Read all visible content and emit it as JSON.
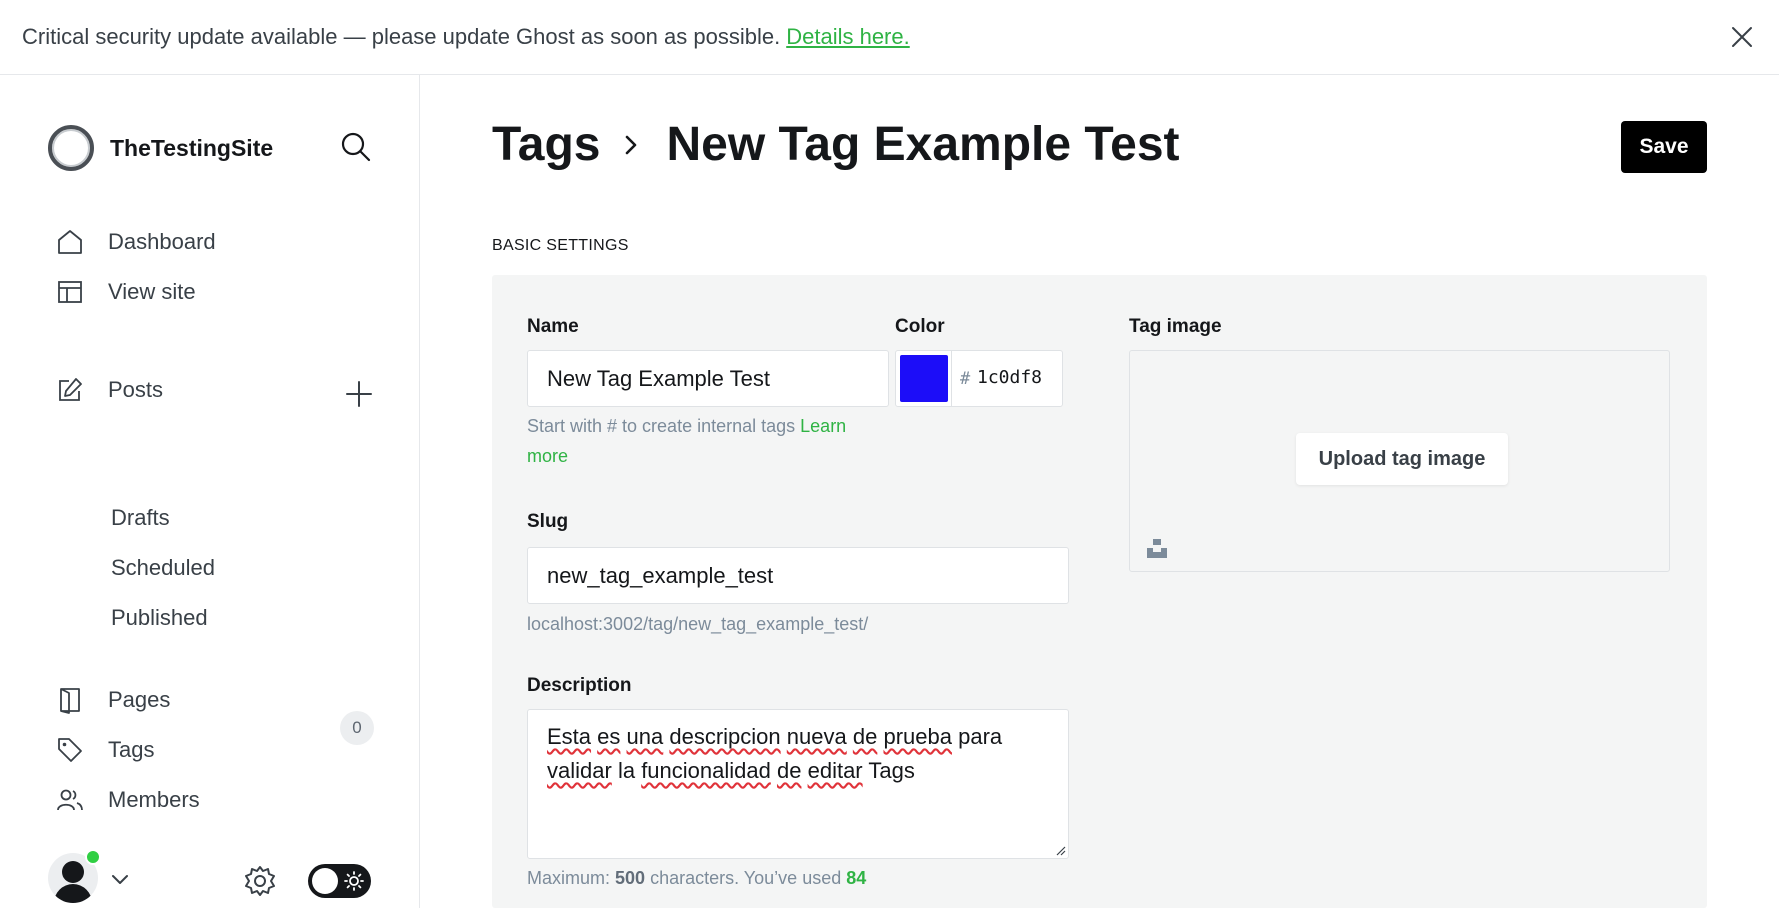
{
  "banner": {
    "text": "Critical security update available — please update Ghost as soon as possible.",
    "link": "Details here."
  },
  "sidebar": {
    "site_name": "TheTestingSite",
    "items": {
      "dashboard": "Dashboard",
      "view_site": "View site",
      "posts": "Posts",
      "drafts": "Drafts",
      "scheduled": "Scheduled",
      "published": "Published",
      "pages": "Pages",
      "tags": "Tags",
      "members": "Members"
    },
    "members_count": "0",
    "online_status_color": "#30cf43"
  },
  "header": {
    "breadcrumb": "Tags",
    "title": "New Tag Example Test",
    "save_label": "Save"
  },
  "form": {
    "section": "BASIC SETTINGS",
    "name_label": "Name",
    "name_value": "New Tag Example Test",
    "name_hint": "Start with # to create internal tags",
    "name_hint_link": "Learn more",
    "color_label": "Color",
    "color_hash": "#",
    "color_value": "1c0df8",
    "color_swatch": "#1c0df8",
    "image_label": "Tag image",
    "upload_label": "Upload tag image",
    "slug_label": "Slug",
    "slug_value": "new_tag_example_test",
    "slug_url": "localhost:3002/tag/new_tag_example_test/",
    "description_label": "Description",
    "description_words": [
      "Esta",
      "es",
      "una",
      "descripcion",
      "nueva",
      "de",
      "prueba",
      "para",
      "validar",
      "la",
      "funcionalidad",
      "de",
      "editar",
      "Tags"
    ],
    "max_label": "Maximum:",
    "max_value": "500",
    "max_suffix": "characters. You’ve used",
    "used_count": "84"
  }
}
